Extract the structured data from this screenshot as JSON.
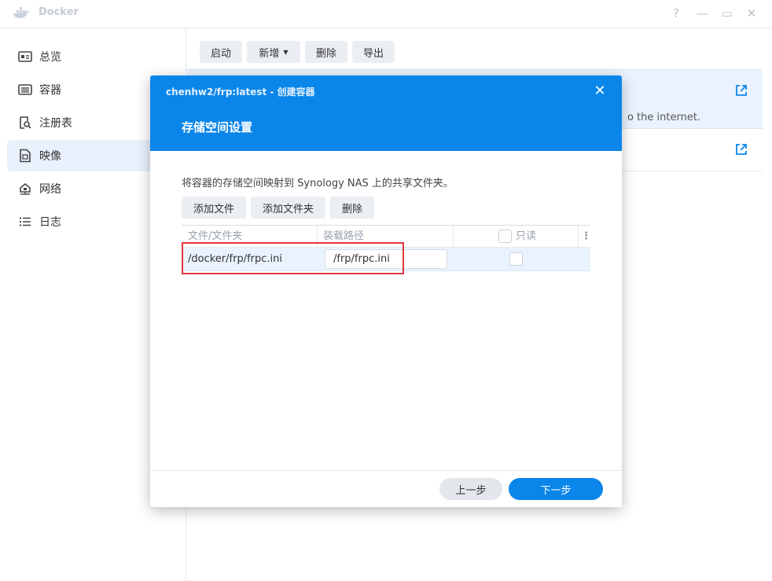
{
  "app": {
    "title": "Docker",
    "logo_icon": "docker-whale-icon"
  },
  "window_controls": {
    "help": "?",
    "minimize": "—",
    "maximize": "▭",
    "close": "✕"
  },
  "sidebar": {
    "items": [
      {
        "label": "总览",
        "icon": "overview-icon"
      },
      {
        "label": "容器",
        "icon": "container-icon"
      },
      {
        "label": "注册表",
        "icon": "registry-search-icon"
      },
      {
        "label": "映像",
        "icon": "image-icon",
        "active": true
      },
      {
        "label": "网络",
        "icon": "network-icon"
      },
      {
        "label": "日志",
        "icon": "log-icon"
      }
    ]
  },
  "toolbar": {
    "start": "启动",
    "new": "新增",
    "delete": "删除",
    "export": "导出"
  },
  "background": {
    "row1_desc": "o the internet."
  },
  "modal": {
    "subtitle": "chenhw2/frp:latest - 创建容器",
    "title": "存储空间设置",
    "description": "将容器的存储空间映射到 Synology NAS 上的共享文件夹。",
    "buttons": {
      "add_file": "添加文件",
      "add_folder": "添加文件夹",
      "delete": "删除"
    },
    "table": {
      "columns": {
        "file": "文件/文件夹",
        "mount": "装载路径",
        "readonly": "只读"
      },
      "rows": [
        {
          "file": "/docker/frp/frpc.ini",
          "mount": "/frp/frpc.ini",
          "readonly": false
        }
      ]
    },
    "footer": {
      "prev": "上一步",
      "next": "下一步"
    }
  },
  "colors": {
    "accent": "#0a86ea",
    "highlight": "#e0393e",
    "row_selected": "#eaf3fd"
  }
}
